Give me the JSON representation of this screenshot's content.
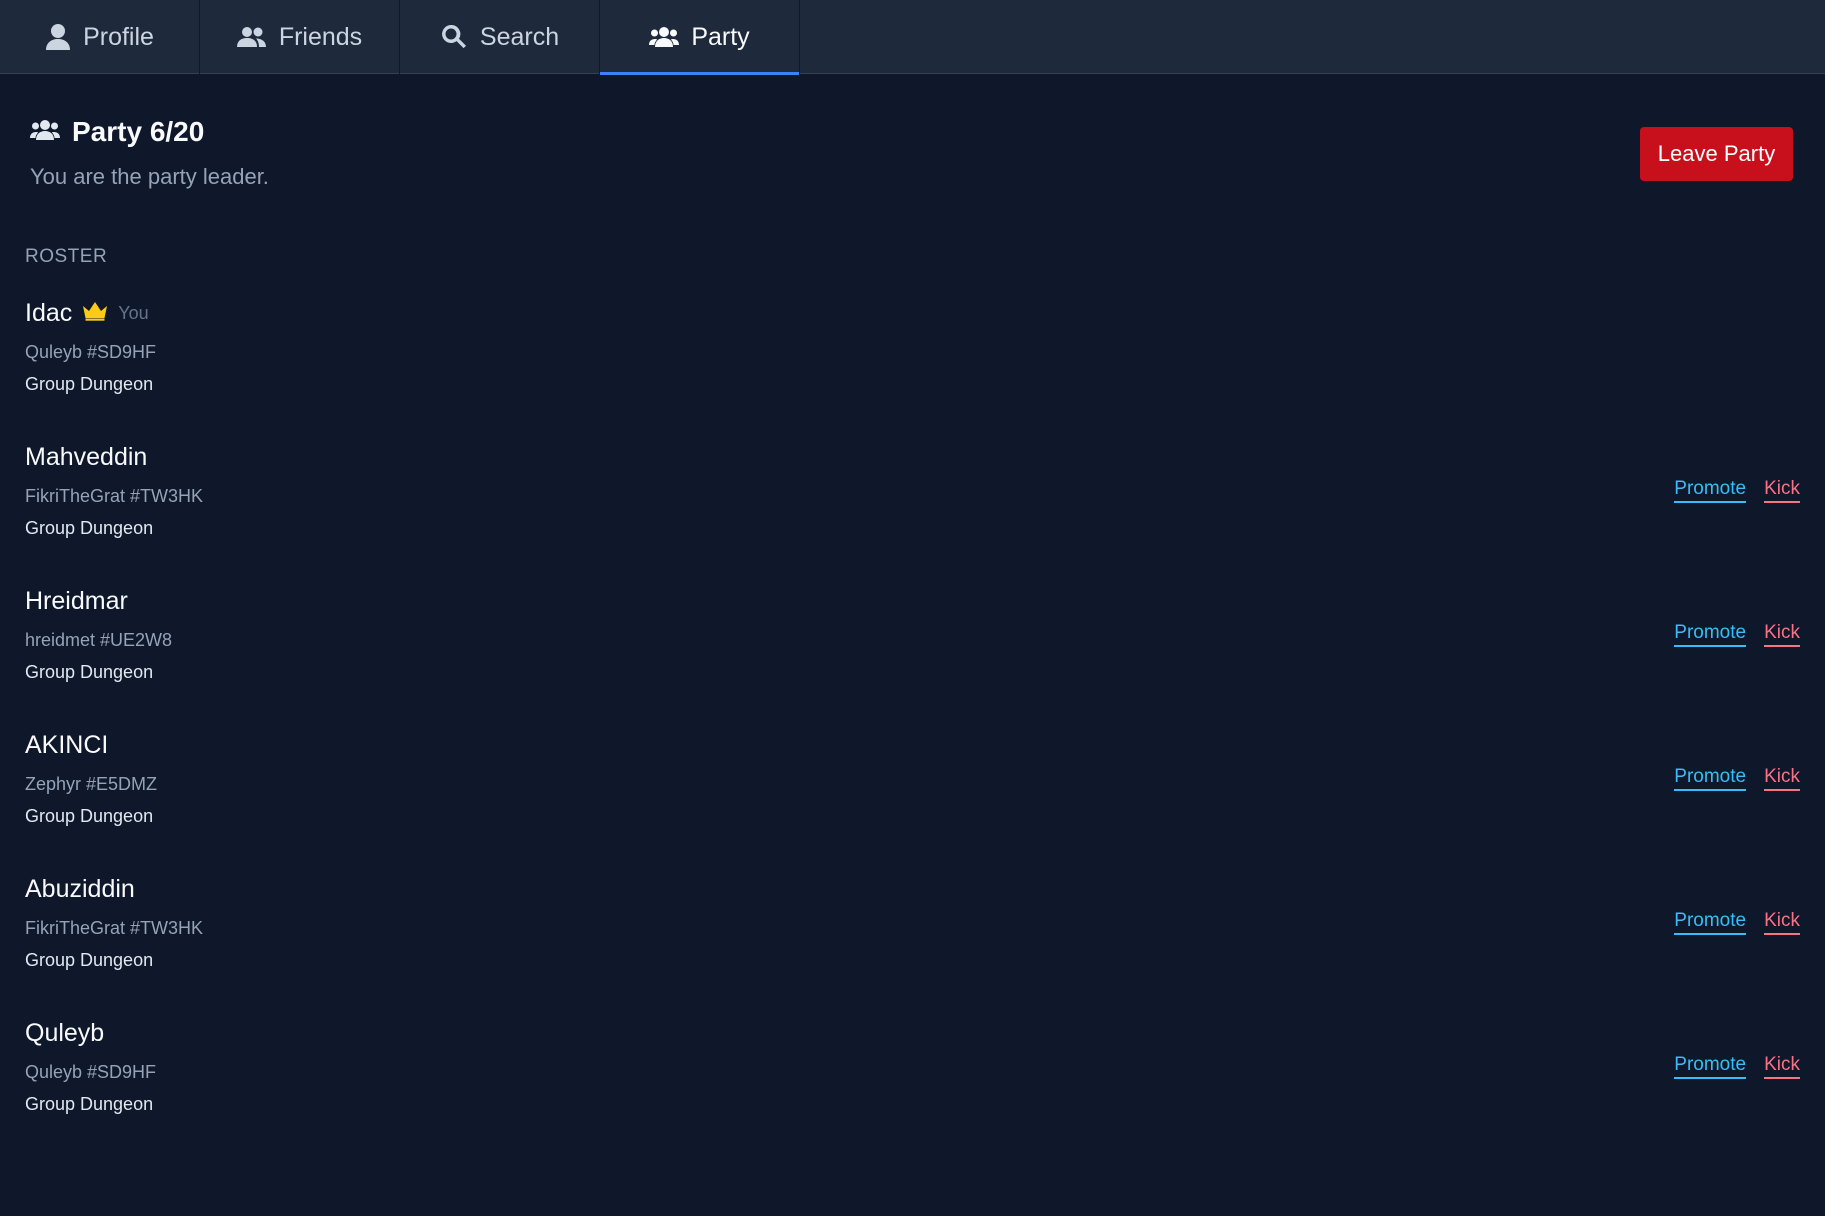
{
  "tabs": [
    {
      "label": "Profile",
      "icon": "user-icon",
      "active": false
    },
    {
      "label": "Friends",
      "icon": "users-icon",
      "active": false
    },
    {
      "label": "Search",
      "icon": "search-icon",
      "active": false
    },
    {
      "label": "Party",
      "icon": "party-icon",
      "active": true
    }
  ],
  "party": {
    "title": "Party 6/20",
    "subtitle": "You are the party leader.",
    "leave_label": "Leave Party"
  },
  "roster": {
    "label": "ROSTER",
    "promote_label": "Promote",
    "kick_label": "Kick",
    "you_label": "You",
    "members": [
      {
        "name": "Idac",
        "tag": "Quleyb #SD9HF",
        "activity": "Group Dungeon",
        "leader": true
      },
      {
        "name": "Mahveddin",
        "tag": "FikriTheGrat #TW3HK",
        "activity": "Group Dungeon",
        "leader": false
      },
      {
        "name": "Hreidmar",
        "tag": "hreidmet #UE2W8",
        "activity": "Group Dungeon",
        "leader": false
      },
      {
        "name": "AKINCI",
        "tag": "Zephyr #E5DMZ",
        "activity": "Group Dungeon",
        "leader": false
      },
      {
        "name": "Abuziddin",
        "tag": "FikriTheGrat #TW3HK",
        "activity": "Group Dungeon",
        "leader": false
      },
      {
        "name": "Quleyb",
        "tag": "Quleyb #SD9HF",
        "activity": "Group Dungeon",
        "leader": false
      }
    ]
  },
  "colors": {
    "background": "#0f172a",
    "tabbar": "#1e293b",
    "accent": "#3b82f6",
    "leave_button": "#c8101c",
    "promote": "#38bdf8",
    "kick": "#fb7185",
    "crown": "#facc15"
  }
}
